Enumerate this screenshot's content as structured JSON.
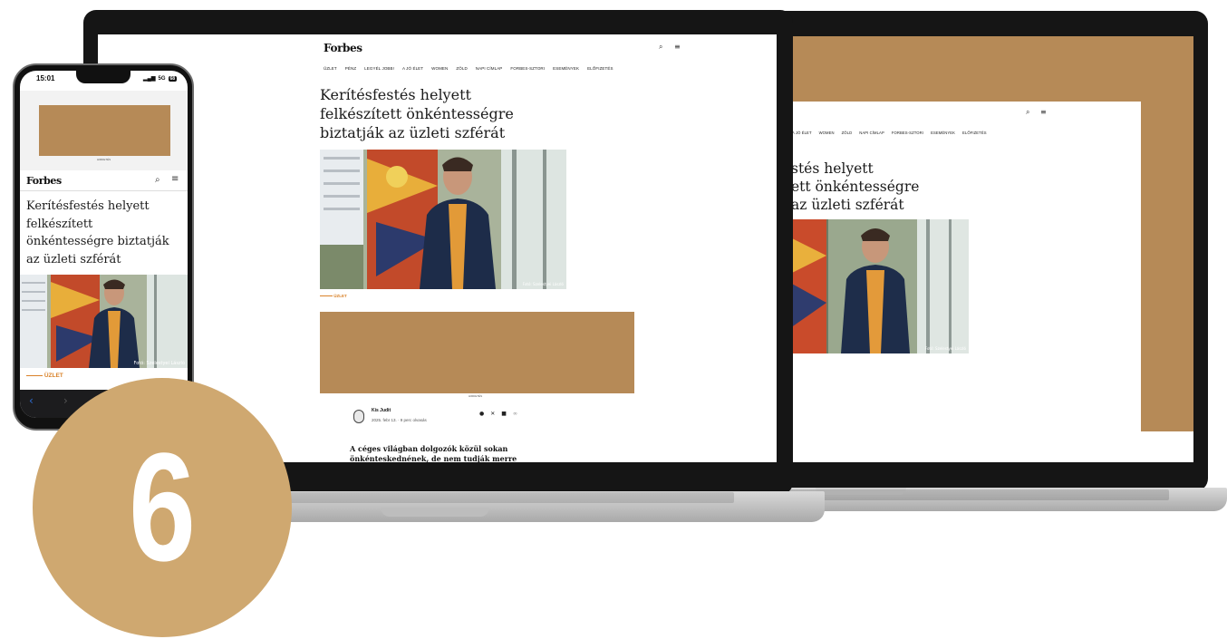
{
  "colors": {
    "ad": "#b68a57",
    "accent": "#d98229",
    "bezel": "#151515",
    "badge": "#cfa870"
  },
  "badge": {
    "number": "6"
  },
  "site": {
    "brand": "Forbes",
    "ad_label": "HIRDETÉS",
    "nav": [
      "ÜZLET",
      "PÉNZ",
      "LEGYÉL JOBB!",
      "A JÓ ÉLET",
      "WOMEN",
      "ZÖLD",
      "NAPI CÍMLAP",
      "FORBES-SZTORI",
      "ESEMÉNYEK",
      "ELŐFIZETÉS"
    ],
    "article": {
      "title": "Kerítésfestés helyett felkészített önkéntességre biztatják az üzleti szférát",
      "desktop_title_lines": [
        "Kerítésfestés helyett",
        "felkészített önkéntességre",
        "biztatják az üzleti szférát"
      ],
      "phone_title_lines": [
        "Kerítésfestés helyett",
        "felkészített",
        "önkéntességre biztatják",
        "az üzleti szférát"
      ],
      "right_title_lines": [
        "stés helyett",
        "ett önkéntességre",
        "az üzleti szférát"
      ],
      "category": "ÜZLET",
      "photo_credit": "Fotó: Szelestyei László",
      "photo_credit_cropped": "Fotó: Szelestyei László",
      "author": "Kis Judit",
      "date": "2025. febr 13.",
      "read_time": "9 perc olvasás",
      "lead": [
        "A céges világban dolgozók közül sokan",
        "önkénteskednének, de nem tudják merre"
      ]
    },
    "right_nav": [
      "A JÓ ÉLET",
      "WOMEN",
      "ZÖLD",
      "NAPI CÍMLAP",
      "FORBES-SZTORI",
      "ESEMÉNYEK",
      "ELŐFIZETÉS"
    ]
  },
  "phone": {
    "time": "15:01",
    "signal": "5G",
    "battery": "68"
  }
}
